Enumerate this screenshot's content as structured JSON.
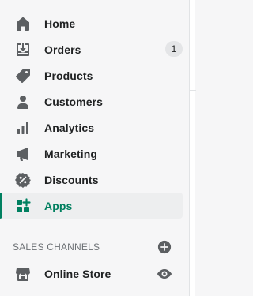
{
  "nav": {
    "items": [
      {
        "label": "Home",
        "icon": "home-icon"
      },
      {
        "label": "Orders",
        "icon": "orders-icon",
        "badge": "1"
      },
      {
        "label": "Products",
        "icon": "tag-icon"
      },
      {
        "label": "Customers",
        "icon": "person-icon"
      },
      {
        "label": "Analytics",
        "icon": "bar-chart-icon"
      },
      {
        "label": "Marketing",
        "icon": "megaphone-icon"
      },
      {
        "label": "Discounts",
        "icon": "discount-icon"
      },
      {
        "label": "Apps",
        "icon": "apps-icon",
        "active": true
      }
    ]
  },
  "sales_channels": {
    "title": "SALES CHANNELS",
    "add_icon": "plus-circle-icon",
    "items": [
      {
        "label": "Online Store",
        "icon": "store-icon",
        "action_icon": "eye-icon"
      }
    ]
  },
  "colors": {
    "active_text": "#007f5f",
    "active_indicator": "#008060",
    "icon": "#5c5f62"
  }
}
